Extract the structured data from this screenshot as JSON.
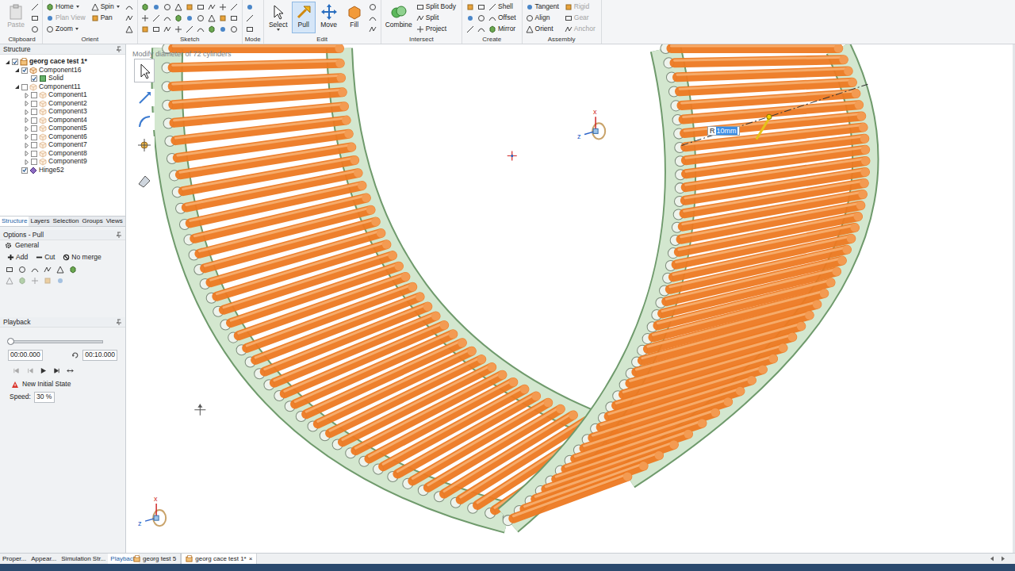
{
  "ribbon": {
    "groups": [
      {
        "label": "Clipboard",
        "tools": [
          {
            "label": "Paste",
            "kind": "large",
            "disabled": true,
            "selected": false,
            "menu": false
          }
        ]
      },
      {
        "label": "Orient",
        "tools": [
          {
            "label": "Home",
            "kind": "small",
            "disabled": false,
            "selected": false,
            "menu": true
          },
          {
            "label": "Plan View",
            "kind": "small",
            "disabled": true,
            "selected": false,
            "menu": false
          },
          {
            "label": "Zoom",
            "kind": "small",
            "disabled": false,
            "selected": false,
            "menu": true
          },
          {
            "label": "Spin",
            "kind": "small",
            "disabled": false,
            "selected": false,
            "menu": true
          },
          {
            "label": "Pan",
            "kind": "small",
            "disabled": false,
            "selected": false,
            "menu": false
          }
        ]
      },
      {
        "label": "Sketch",
        "tools": []
      },
      {
        "label": "Mode",
        "tools": []
      },
      {
        "label": "Edit",
        "tools": [
          {
            "label": "Select",
            "kind": "large",
            "disabled": false,
            "selected": false,
            "menu": true
          },
          {
            "label": "Pull",
            "kind": "large",
            "disabled": false,
            "selected": true,
            "menu": false
          },
          {
            "label": "Move",
            "kind": "large",
            "disabled": false,
            "selected": false,
            "menu": false
          },
          {
            "label": "Fill",
            "kind": "large",
            "disabled": false,
            "selected": false,
            "menu": false
          }
        ]
      },
      {
        "label": "Intersect",
        "tools": [
          {
            "label": "Combine",
            "kind": "large",
            "disabled": false,
            "selected": false,
            "menu": false
          },
          {
            "label": "Split Body",
            "kind": "small",
            "disabled": false,
            "selected": false,
            "menu": false
          },
          {
            "label": "Split",
            "kind": "small",
            "disabled": false,
            "selected": false,
            "menu": false
          },
          {
            "label": "Project",
            "kind": "small",
            "disabled": false,
            "selected": false,
            "menu": false
          }
        ]
      },
      {
        "label": "Create",
        "tools": [
          {
            "label": "Shell",
            "kind": "small",
            "disabled": false,
            "selected": false,
            "menu": false
          },
          {
            "label": "Offset",
            "kind": "small",
            "disabled": false,
            "selected": false,
            "menu": false
          },
          {
            "label": "Mirror",
            "kind": "small",
            "disabled": false,
            "selected": false,
            "menu": false
          }
        ]
      },
      {
        "label": "Assembly",
        "tools": [
          {
            "label": "Tangent",
            "kind": "small",
            "disabled": false,
            "selected": false,
            "menu": false
          },
          {
            "label": "Align",
            "kind": "small",
            "disabled": false,
            "selected": false,
            "menu": false
          },
          {
            "label": "Orient",
            "kind": "small",
            "disabled": false,
            "selected": false,
            "menu": false
          },
          {
            "label": "Rigid",
            "kind": "small",
            "disabled": true,
            "selected": false,
            "menu": false
          },
          {
            "label": "Gear",
            "kind": "small",
            "disabled": true,
            "selected": false,
            "menu": false
          },
          {
            "label": "Anchor",
            "kind": "small",
            "disabled": true,
            "selected": false,
            "menu": false
          }
        ]
      }
    ]
  },
  "structure": {
    "title": "Structure",
    "tree": [
      {
        "label": "georg cace test 1*",
        "kind": "document",
        "expanded": true,
        "checked": true,
        "selected": false,
        "children": [
          {
            "label": "Component16",
            "kind": "component",
            "expanded": true,
            "checked": true,
            "selected": false,
            "children": [
              {
                "label": "Solid",
                "kind": "body",
                "expanded": false,
                "checked": true,
                "selected": false
              }
            ]
          },
          {
            "label": "Component11",
            "kind": "component",
            "expanded": true,
            "checked": false,
            "selected": false,
            "children": [
              {
                "label": "Component1",
                "kind": "component",
                "expanded": false,
                "checked": false,
                "selected": false,
                "children": []
              },
              {
                "label": "Component2",
                "kind": "component",
                "expanded": false,
                "checked": false,
                "selected": false,
                "children": []
              },
              {
                "label": "Component3",
                "kind": "component",
                "expanded": false,
                "checked": false,
                "selected": false,
                "children": []
              },
              {
                "label": "Component4",
                "kind": "component",
                "expanded": false,
                "checked": false,
                "selected": false,
                "children": []
              },
              {
                "label": "Component5",
                "kind": "component",
                "expanded": false,
                "checked": false,
                "selected": false,
                "children": []
              },
              {
                "label": "Component6",
                "kind": "component",
                "expanded": false,
                "checked": false,
                "selected": false,
                "children": []
              },
              {
                "label": "Component7",
                "kind": "component",
                "expanded": false,
                "checked": false,
                "selected": false,
                "children": []
              },
              {
                "label": "Component8",
                "kind": "component",
                "expanded": false,
                "checked": false,
                "selected": false,
                "children": []
              },
              {
                "label": "Component9",
                "kind": "component",
                "expanded": false,
                "checked": false,
                "selected": false,
                "children": []
              }
            ]
          },
          {
            "label": "Hinge52",
            "kind": "joint",
            "expanded": false,
            "checked": true,
            "selected": false
          }
        ]
      }
    ]
  },
  "panel_tabs": [
    {
      "label": "Structure",
      "selected": true
    },
    {
      "label": "Layers",
      "selected": false
    },
    {
      "label": "Selection",
      "selected": false
    },
    {
      "label": "Groups",
      "selected": false
    },
    {
      "label": "Views",
      "selected": false
    }
  ],
  "options": {
    "title": "Options - Pull",
    "section": "General",
    "modes": [
      {
        "label": "Add",
        "selected": false
      },
      {
        "label": "Cut",
        "selected": false
      },
      {
        "label": "No merge",
        "selected": false
      }
    ]
  },
  "playback": {
    "title": "Playback",
    "level": 0,
    "start": "00:00.000",
    "end": "00:10.000",
    "action": "New Initial State",
    "speed_label": "Speed:",
    "speed": "30 %"
  },
  "canvas": {
    "hint": "Modify diameter of 72 cylinders",
    "dimension": {
      "prefix": "R",
      "value": "10mm",
      "editing": true
    },
    "triads": [
      {
        "up": "x",
        "left": "z"
      },
      {
        "up": "x",
        "left": "z"
      }
    ]
  },
  "bottom_tabs": [
    {
      "label": "Proper...",
      "selected": false
    },
    {
      "label": "Appear...",
      "selected": false
    },
    {
      "label": "Simulation Str...",
      "selected": false
    },
    {
      "label": "Playback",
      "selected": true
    }
  ],
  "doc_tabs": [
    {
      "label": "georg test 5",
      "selected": false
    },
    {
      "label": "georg cace test 1*",
      "selected": true,
      "close": "×"
    }
  ]
}
